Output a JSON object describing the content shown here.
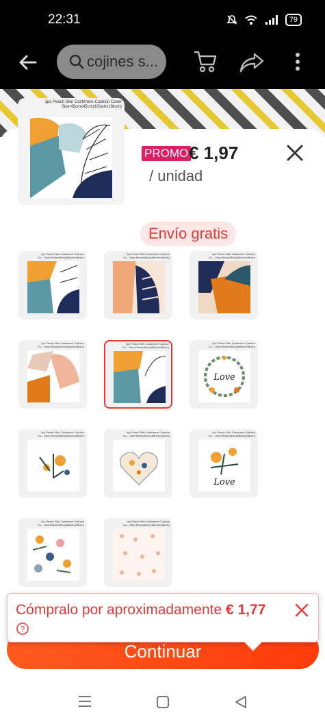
{
  "status_bar": {
    "time": "22:31",
    "battery": "79"
  },
  "header": {
    "search_text": "cojines s..."
  },
  "product": {
    "image_caption": "1pc Peach Skin Cashmere Cushion Cover Size:45cmx45cm(18inchx18inch)",
    "promo_label": "PROMO",
    "price": "€ 1,97",
    "unit": "/ unidad"
  },
  "shipping": {
    "label": "Envío gratis"
  },
  "variants": [
    {
      "caption": "1pc Peach Skin Cashmere Cushion Co... Size:45cmx45cm(18inchx18inch)",
      "style": "orange-leaf"
    },
    {
      "caption": "1pc Peach Skin Cashmere Cushion Co... Size:45cmx45cm(18inchx18inch)",
      "style": "navy-leaf"
    },
    {
      "caption": "1pc Peach Skin Cashmere Cushion Co... Size:45cmx45cm(18inchx18inch)",
      "style": "navy-orange"
    },
    {
      "caption": "1pc Peach Skin Cashmere Cushion Co... Size:45cmx45cm(18inchx18inch)",
      "style": "orange-abstract"
    },
    {
      "caption": "1pc Peach Skin Cashmere Cushion Co... Size:45cmx45cm(18inchx18inch)",
      "style": "teal-leaf",
      "selected": true
    },
    {
      "caption": "1pc Peach Skin Cashmere Cushion Co... Size:45cmx45cm(18inchx18inch)",
      "style": "love-wreath",
      "text": "Love"
    },
    {
      "caption": "1pc Peach Skin Cashmere Cushion Co... Size:45cmx45cm(18inchx18inch)",
      "style": "flowers"
    },
    {
      "caption": "1pc Peach Skin Cashmere Cushion Co... Size:45cmx45cm(18inchx18inch)",
      "style": "heart"
    },
    {
      "caption": "1pc Peach Skin Cashmere Cushion Co... Size:45cmx45cm(18inchx18inch)",
      "style": "love-flowers",
      "text": "Love"
    },
    {
      "caption": "1pc Peach Skin Cashmere Cushion Co... Size:45cmx45cm(18inchx18inch)",
      "style": "floral-pattern"
    },
    {
      "caption": "1pc Peach Skin Cashmere Cushion Co... Size:45cmx45cm(18inchx18inch)",
      "style": "pink-pattern"
    }
  ],
  "tooltip": {
    "text": "Cómpralo por aproximadamente ",
    "price": "€ 1,77"
  },
  "continue_label": "Continuar",
  "colors": {
    "accent": "#e53935",
    "promo": "#e01e63",
    "button": "#ff4a14"
  },
  "icons": [
    "arrow-left-icon",
    "search-icon",
    "cart-icon",
    "share-icon",
    "more-icon",
    "close-icon",
    "info-icon",
    "menu-icon",
    "home-icon",
    "back-triangle-icon",
    "mute-icon",
    "wifi-icon",
    "signal-icon",
    "battery-icon"
  ]
}
